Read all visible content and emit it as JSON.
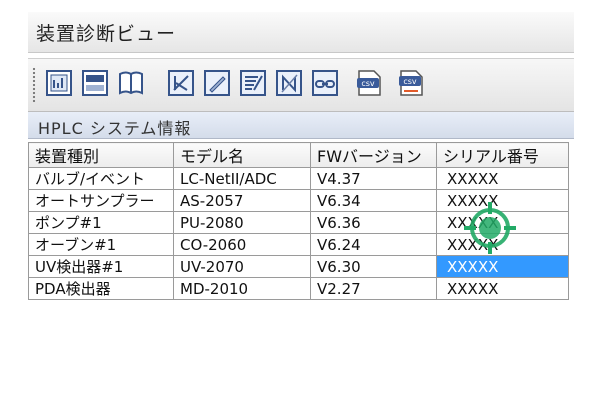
{
  "window": {
    "title": "装置診断ビュー"
  },
  "toolbar": {
    "buttons": [
      {
        "name": "chart-icon"
      },
      {
        "name": "device-icon"
      },
      {
        "name": "book-icon"
      },
      {
        "name": "edit-k-icon"
      },
      {
        "name": "edit-pen-icon"
      },
      {
        "name": "edit-list-icon"
      },
      {
        "name": "edit-n-icon"
      },
      {
        "name": "link-icon"
      },
      {
        "name": "csv-export-icon"
      },
      {
        "name": "csv-export-all-icon"
      }
    ],
    "csv_label": "csv"
  },
  "section": {
    "title": "HPLC システム情報"
  },
  "table": {
    "headers": [
      "装置種別",
      "モデル名",
      "FWバージョン",
      "シリアル番号"
    ],
    "rows": [
      [
        "バルブ/イベント",
        "LC-NetII/ADC",
        "V4.37",
        "XXXXX"
      ],
      [
        "オートサンプラー",
        "AS-2057",
        "V6.34",
        "XXXXX"
      ],
      [
        "ポンプ#1",
        "PU-2080",
        "V6.36",
        "XXXXX"
      ],
      [
        "オーブン#1",
        "CO-2060",
        "V6.24",
        "XXXXX"
      ],
      [
        "UV検出器#1",
        "UV-2070",
        "V6.30",
        "XXXXX"
      ],
      [
        "PDA検出器",
        "MD-2010",
        "V2.27",
        "XXXXX"
      ]
    ],
    "selected_cell": {
      "row": 4,
      "col": 3
    }
  },
  "colors": {
    "selection": "#3399ff",
    "cursor": "#22aa66"
  }
}
